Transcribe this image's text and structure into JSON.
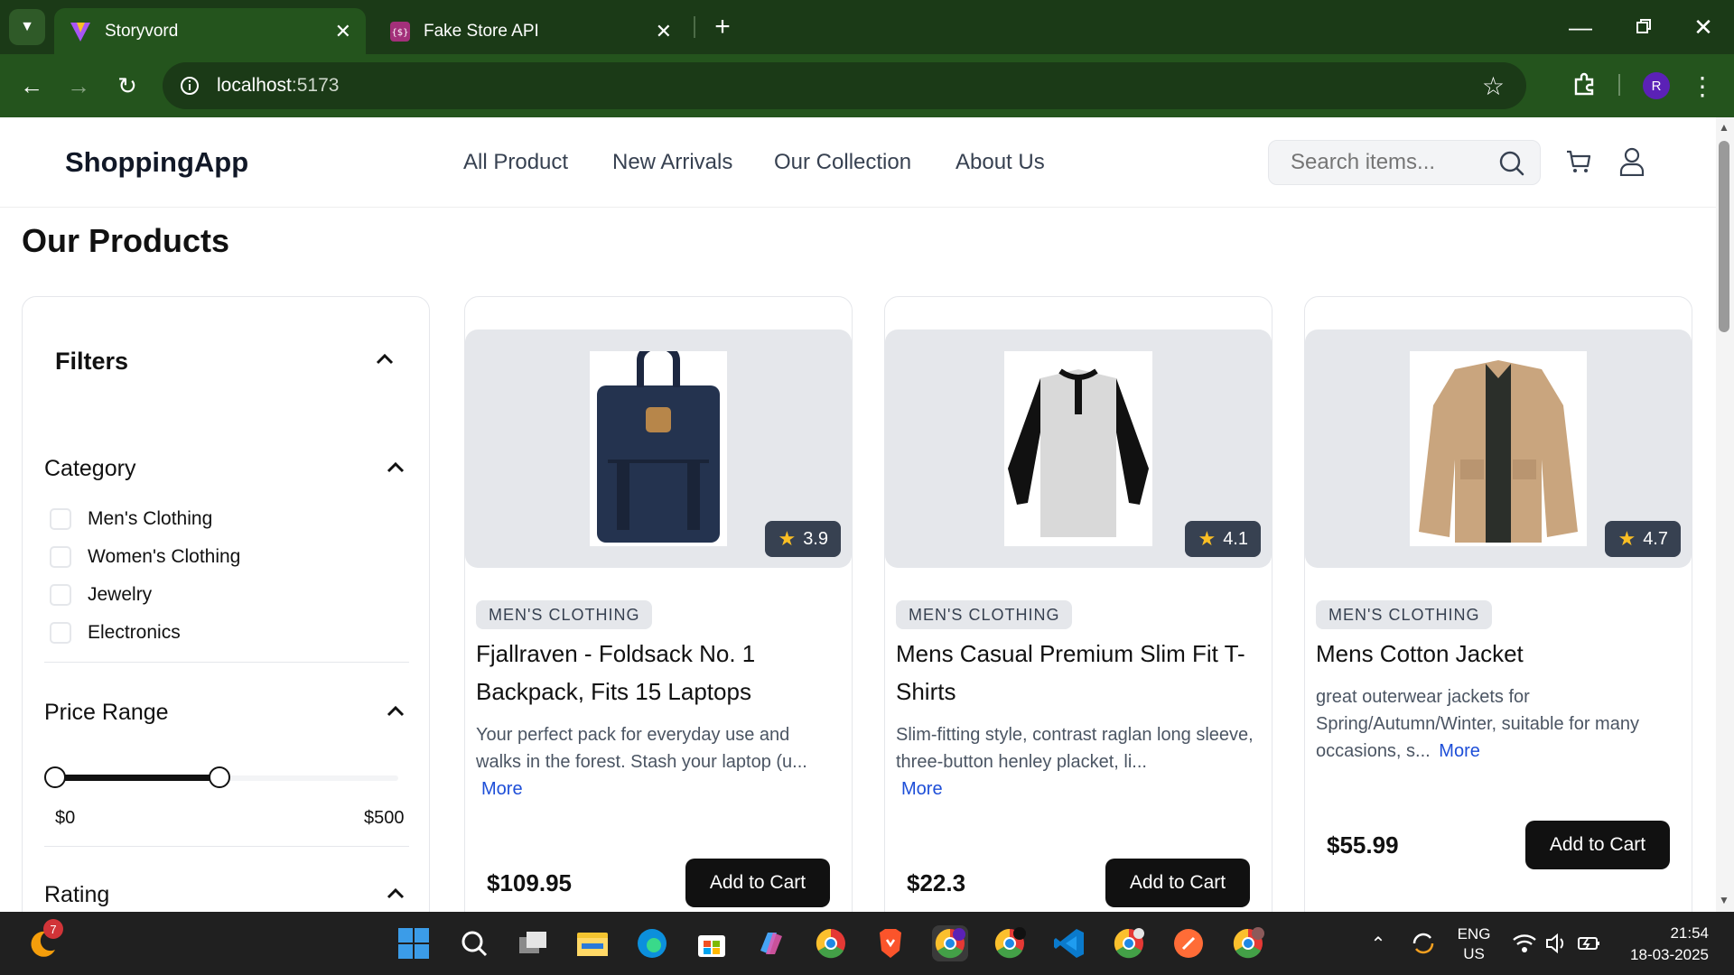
{
  "browser": {
    "tabs": [
      {
        "title": "Storyvord",
        "active": true
      },
      {
        "title": "Fake Store API",
        "active": false
      }
    ],
    "url_host": "localhost",
    "url_port": ":5173",
    "profile_initial": "R"
  },
  "header": {
    "brand": "ShoppingApp",
    "nav": [
      "All Product",
      "New Arrivals",
      "Our Collection",
      "About Us"
    ],
    "search_placeholder": "Search items..."
  },
  "page_title": "Our Products",
  "filters": {
    "title": "Filters",
    "category_label": "Category",
    "categories": [
      "Men's Clothing",
      "Women's Clothing",
      "Jewelry",
      "Electronics"
    ],
    "price_label": "Price Range",
    "price_min": "$0",
    "price_max": "$500",
    "price_slider_fraction": 0.5,
    "rating_label": "Rating"
  },
  "products": [
    {
      "rating": "3.9",
      "category": "MEN'S CLOTHING",
      "title": "Fjallraven - Foldsack No. 1 Backpack, Fits 15 Laptops",
      "description": "Your perfect pack for everyday use and walks in the forest. Stash your laptop (u...",
      "more": "More",
      "price": "$109.95",
      "button": "Add to Cart"
    },
    {
      "rating": "4.1",
      "category": "MEN'S CLOTHING",
      "title": "Mens Casual Premium Slim Fit T-Shirts",
      "description": "Slim-fitting style, contrast raglan long sleeve, three-button henley placket, li...",
      "more": "More",
      "price": "$22.3",
      "button": "Add to Cart"
    },
    {
      "rating": "4.7",
      "category": "MEN'S CLOTHING",
      "title": "Mens Cotton Jacket",
      "description": "great outerwear jackets for Spring/Autumn/Winter, suitable for many occasions, s...",
      "more": "More",
      "price": "$55.99",
      "button": "Add to Cart"
    }
  ],
  "taskbar": {
    "lang_line1": "ENG",
    "lang_line2": "US",
    "time": "21:54",
    "date": "18-03-2025",
    "notification_count": "7"
  },
  "colors": {
    "tabbar": "#1b3a17",
    "toolbar": "#24541d",
    "accent_link": "#1d4ed8"
  }
}
